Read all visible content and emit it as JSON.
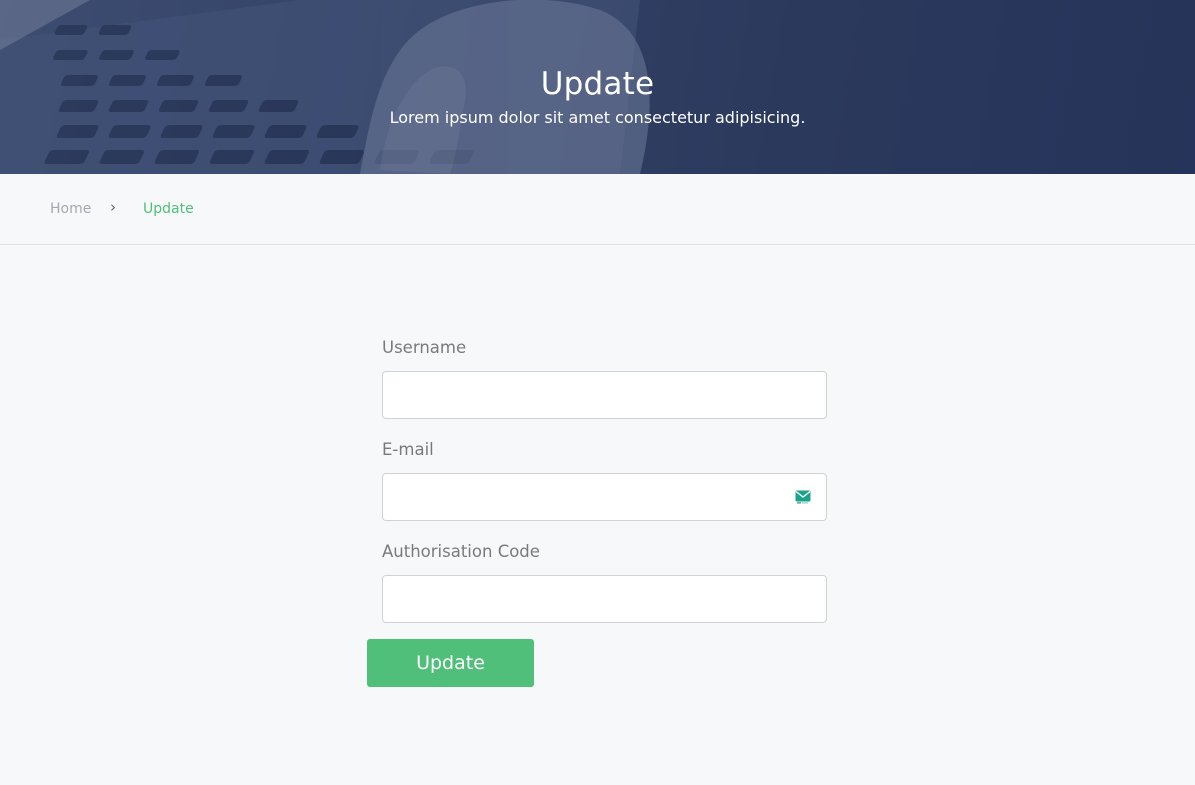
{
  "hero": {
    "title": "Update",
    "subtitle": "Lorem ipsum dolor sit amet consectetur adipisicing."
  },
  "breadcrumb": {
    "home": "Home",
    "separator": "›",
    "current": "Update"
  },
  "form": {
    "username": {
      "label": "Username",
      "value": "",
      "placeholder": ""
    },
    "email": {
      "label": "E-mail",
      "value": "",
      "placeholder": "",
      "icon": "mail-icon"
    },
    "auth_code": {
      "label": "Authorisation Code",
      "value": "",
      "placeholder": ""
    },
    "submit_label": "Update"
  },
  "colors": {
    "accent": "#4fbf79",
    "hero_tint": "#2f3d5e",
    "page_bg": "#f7f8fa"
  }
}
